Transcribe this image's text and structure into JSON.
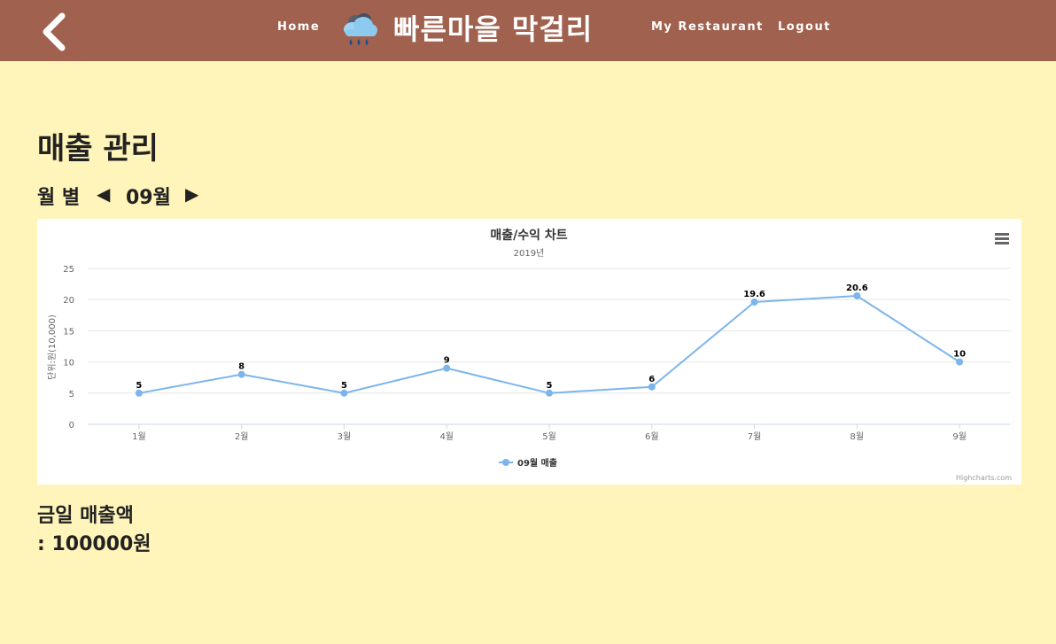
{
  "nav": {
    "home": "Home",
    "logo_text": "빠른마을 막걸리",
    "my_restaurant": "My Restaurant",
    "logout": "Logout",
    "icons": {
      "back": "chevron-left-icon",
      "logo": "rain-cloud-icon"
    }
  },
  "page": {
    "title": "매출 관리",
    "period_label": "월 별",
    "current_month": "09월",
    "prev_symbol": "◀",
    "next_symbol": "▶"
  },
  "chart_data": {
    "type": "line",
    "title": "매출/수익 차트",
    "subtitle": "2019년",
    "ylabel": "단위:원(10,000)",
    "xlabel": "",
    "categories": [
      "1월",
      "2월",
      "3월",
      "4월",
      "5월",
      "6월",
      "7월",
      "8월",
      "9월"
    ],
    "series": [
      {
        "name": "09월 매출",
        "values": [
          5,
          8,
          5,
          9,
          5,
          6,
          19.6,
          20.6,
          10
        ]
      }
    ],
    "ylim": [
      0,
      25
    ],
    "yticks": [
      0,
      5,
      10,
      15,
      20,
      25
    ],
    "grid": true,
    "legend_position": "bottom-center",
    "credits": "Highcharts.com",
    "line_color": "#7cb5ec",
    "menu_icon": "hamburger-menu-icon"
  },
  "summary": {
    "label": "금일 매출액",
    "value": ": 100000원"
  },
  "colors": {
    "navbar": "#a0614f",
    "background": "#fff4b9",
    "series": "#7cb5ec"
  }
}
